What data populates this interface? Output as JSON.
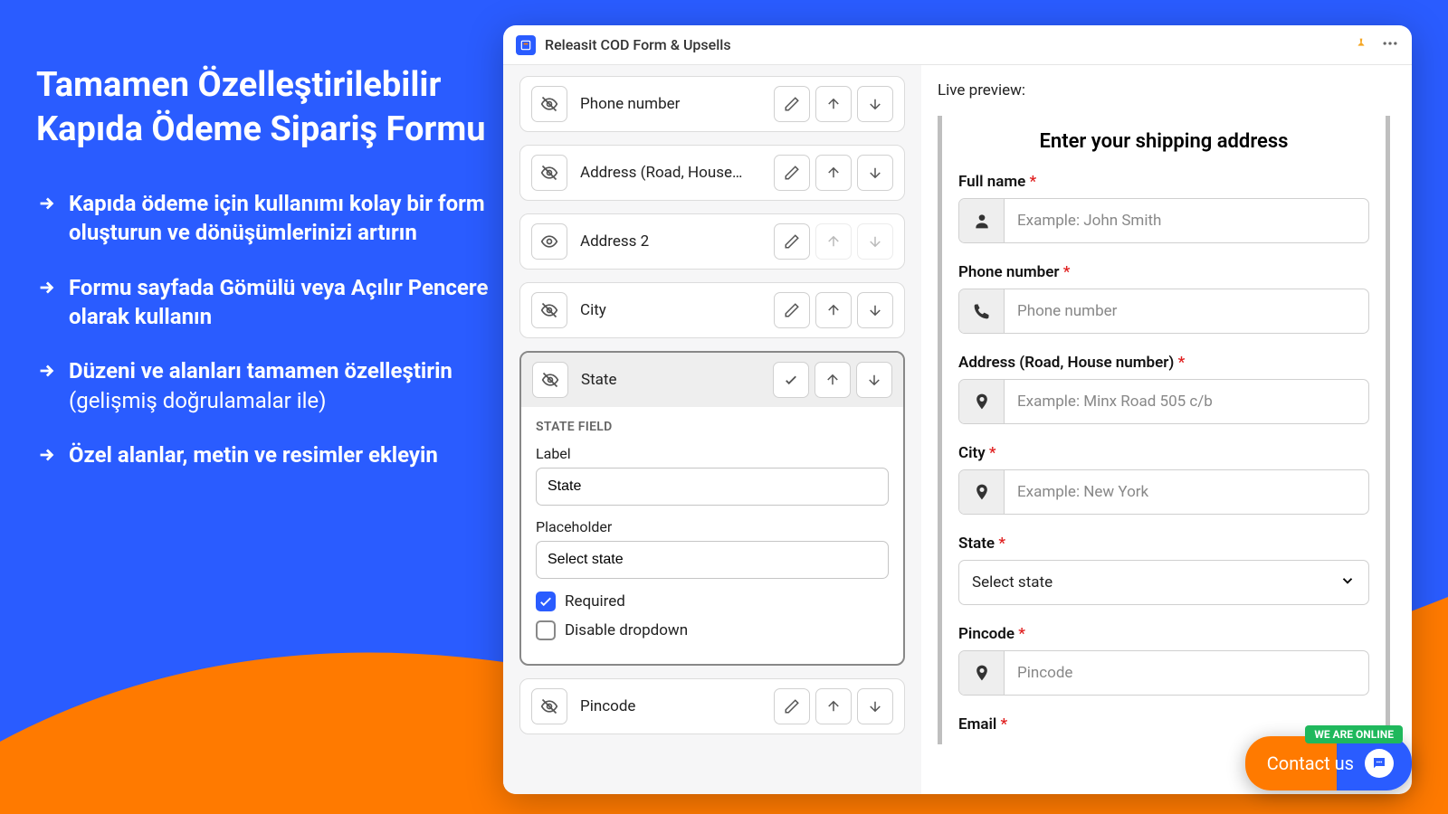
{
  "promo": {
    "title": "Tamamen Özelleştirilebilir Kapıda Ödeme Sipariş Formu",
    "bullets": [
      {
        "strong": "Kapıda ödeme için kullanımı kolay bir form oluşturun ve dönüşümlerinizi artırın",
        "rest": ""
      },
      {
        "strong": "Formu sayfada Gömülü veya Açılır Pencere olarak kullanın",
        "rest": ""
      },
      {
        "strong": "Düzeni ve alanları tamamen özelleştirin",
        "rest": " (gelişmiş doğrulamalar ile)"
      },
      {
        "strong": "Özel alanlar, metin ve resimler ekleyin",
        "rest": ""
      }
    ]
  },
  "app": {
    "title": "Releasit COD Form & Upsells",
    "fields": [
      {
        "label": "Phone number",
        "hidden": true,
        "actions": [
          "edit",
          "up",
          "down"
        ]
      },
      {
        "label": "Address (Road, House…",
        "hidden": true,
        "actions": [
          "edit",
          "up",
          "down"
        ]
      },
      {
        "label": "Address 2",
        "hidden": false,
        "actions": [
          "edit",
          "up",
          "down"
        ],
        "disabledActions": true
      },
      {
        "label": "City",
        "hidden": true,
        "actions": [
          "edit",
          "up",
          "down"
        ]
      },
      {
        "label": "State",
        "hidden": true,
        "actions": [
          "check",
          "up",
          "down"
        ],
        "active": true
      },
      {
        "label": "Pincode",
        "hidden": true,
        "actions": [
          "edit",
          "up",
          "down"
        ]
      }
    ],
    "stateField": {
      "section": "STATE FIELD",
      "labelLabel": "Label",
      "labelValue": "State",
      "placeholderLabel": "Placeholder",
      "placeholderValue": "Select state",
      "requiredLabel": "Required",
      "requiredChecked": true,
      "disableLabel": "Disable dropdown",
      "disableChecked": false
    }
  },
  "preview": {
    "title": "Live preview:",
    "heading": "Enter your shipping address",
    "fields": [
      {
        "label": "Full name",
        "req": true,
        "icon": "person",
        "placeholder": "Example: John Smith"
      },
      {
        "label": "Phone number",
        "req": true,
        "icon": "phone",
        "placeholder": "Phone number"
      },
      {
        "label": "Address (Road, House number)",
        "req": true,
        "icon": "pin",
        "placeholder": "Example: Minx Road 505 c/b"
      },
      {
        "label": "City",
        "req": true,
        "icon": "pin",
        "placeholder": "Example: New York"
      },
      {
        "label": "State",
        "req": true,
        "type": "select",
        "placeholder": "Select state"
      },
      {
        "label": "Pincode",
        "req": true,
        "icon": "pin",
        "placeholder": "Pincode"
      },
      {
        "label": "Email",
        "req": true,
        "icon": "",
        "placeholder": ""
      }
    ]
  },
  "contact": {
    "label": "Contact us",
    "online": "WE ARE ONLINE"
  }
}
